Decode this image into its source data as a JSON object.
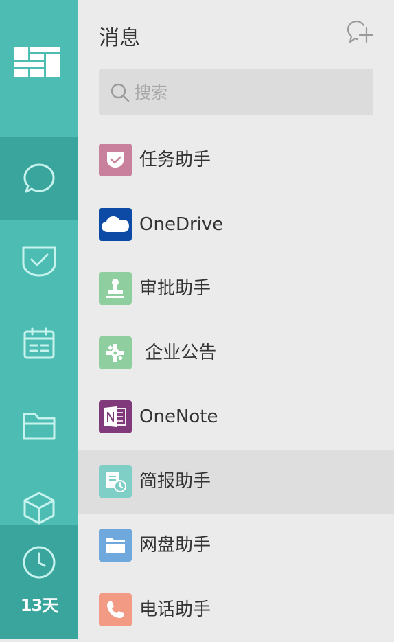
{
  "sidebar": {
    "logo_icon": "app-logo-icon",
    "items": [
      {
        "icon": "chat-bubble-icon",
        "active": true
      },
      {
        "icon": "task-check-icon",
        "active": false
      },
      {
        "icon": "calendar-icon",
        "active": false
      },
      {
        "icon": "folder-icon",
        "active": false
      },
      {
        "icon": "cube-icon",
        "active": false
      }
    ],
    "trial_icon": "clock-icon",
    "trial_days": "13天",
    "colors": {
      "background": "#4dbdb3",
      "active": "#3aa59c",
      "icon": "#c7f3ee"
    }
  },
  "header": {
    "title": "消息",
    "new_chat_icon": "new-chat-icon"
  },
  "search": {
    "placeholder": "搜索",
    "value": "",
    "icon": "search-icon"
  },
  "conversations": [
    {
      "name": "任务助手",
      "icon": "task-assistant-icon",
      "color": "#c9809c",
      "selected": false
    },
    {
      "name": "OneDrive",
      "icon": "onedrive-icon",
      "color": "#0c4aa6",
      "selected": false
    },
    {
      "name": "审批助手",
      "icon": "approval-stamp-icon",
      "color": "#8fcf9f",
      "selected": false
    },
    {
      "name": " 企业公告",
      "icon": "puzzle-icon",
      "color": "#8fcf9f",
      "selected": false
    },
    {
      "name": "OneNote",
      "icon": "onenote-icon",
      "color": "#80397b",
      "selected": false
    },
    {
      "name": "简报助手",
      "icon": "report-icon",
      "color": "#7fcfc6",
      "selected": true
    },
    {
      "name": "网盘助手",
      "icon": "cloud-disk-folder-icon",
      "color": "#6ea8dc",
      "selected": false
    },
    {
      "name": "电话助手",
      "icon": "phone-icon",
      "color": "#f29a84",
      "selected": false
    }
  ]
}
